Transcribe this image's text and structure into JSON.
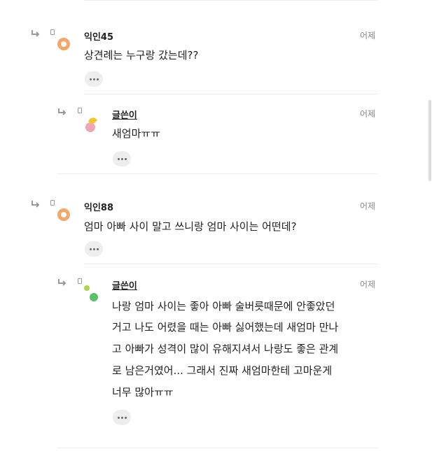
{
  "comments": [
    {
      "name": "익인45",
      "time": "어제",
      "text": [
        "상견례는 누구랑 갔는데??"
      ],
      "replies": [
        {
          "name": "글쓴이",
          "time": "어제",
          "text": [
            "새엄마ㅠㅠ"
          ]
        }
      ]
    },
    {
      "name": "익인88",
      "time": "어제",
      "text": [
        "엄마 아빠 사이 말고 쓰니랑 엄마 사이는 어떤데?"
      ],
      "replies": [
        {
          "name": "글쓴이",
          "time": "어제",
          "text": [
            "나랑 엄마 사이는 좋아 아빠 술버릇때문에 안좋았던",
            "거고 나도 어렸을 때는 아빠 싫어했는데 새엄마 만나",
            "고 아빠가 성격이 많이 유해지셔서 나랑도 좋은 관계",
            "로 남은거였어... 그래서 진짜 새엄마한테 고마운게",
            "너무 많아ㅠㅠ"
          ]
        }
      ]
    }
  ],
  "colors": {
    "avatar_orange": "#f4a76b",
    "avatar_yellow": "#f5c530",
    "avatar_pink": "#f0a6b8",
    "avatar_green": "#58c26a",
    "avatar_lime": "#a7d94a"
  },
  "icons": {
    "reply": "reply-arrow-icon",
    "more": "more-dots-icon"
  }
}
